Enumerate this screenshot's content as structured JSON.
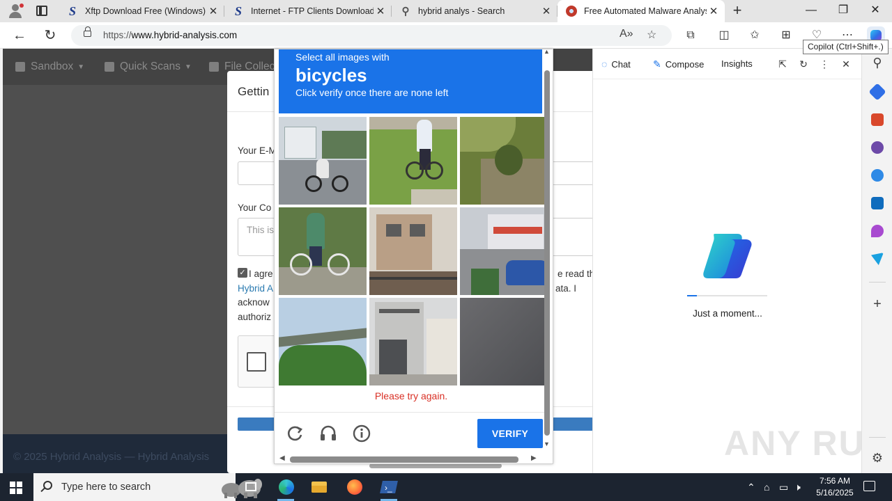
{
  "browser": {
    "tabs": [
      {
        "title": "Xftp Download Free (Windows) -",
        "favicon": "s-icon"
      },
      {
        "title": "Internet - FTP Clients Downloads",
        "favicon": "s-icon"
      },
      {
        "title": "hybrid analys - Search",
        "favicon": "search-icon"
      },
      {
        "title": "Free Automated Malware Analysi",
        "favicon": "hybrid-analysis-icon"
      }
    ],
    "url_scheme": "https://",
    "url_host": "www.hybrid-analysis.com",
    "tooltip": "Copilot (Ctrl+Shift+.)"
  },
  "page": {
    "nav": [
      "Sandbox",
      "Quick Scans",
      "File Collec"
    ],
    "modal_title": "Gettin",
    "email_label": "Your E-M",
    "comment_label": "Your Co",
    "comment_placeholder": "This is",
    "agree_lines": [
      "I agre",
      "Hybrid A",
      "acknow",
      "authoriz"
    ],
    "agree_right": [
      "e read the",
      "ata. I"
    ],
    "footer": "© 2025 Hybrid Analysis — Hybrid Analysis"
  },
  "captcha": {
    "instruction": "Select all images with",
    "keyword": "bicycles",
    "subinstruction": "Click verify once there are none left",
    "error": "Please try again.",
    "verify_label": "VERIFY",
    "tiles": [
      "cyclist on street",
      "cyclist on grass",
      "overgrown wall",
      "cyclist by field",
      "house front",
      "street with cars",
      "overpass and trees",
      "building facade",
      "road surface"
    ]
  },
  "copilot": {
    "tabs": [
      "Chat",
      "Compose",
      "Insights"
    ],
    "status": "Just a moment...",
    "progress": 0.12,
    "watermark": "ANY RUN"
  },
  "taskbar": {
    "search_placeholder": "Type here to search",
    "time": "7:56 AM",
    "date": "5/16/2025"
  },
  "colors": {
    "captcha_blue": "#1a73e8",
    "error_red": "#d93025"
  }
}
